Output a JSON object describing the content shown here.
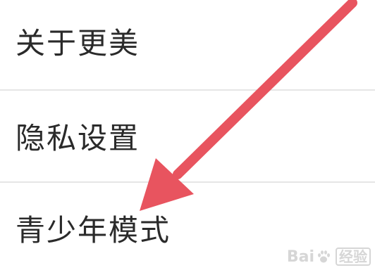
{
  "menu": {
    "items": [
      {
        "label": "关于更美"
      },
      {
        "label": "隐私设置"
      },
      {
        "label": "青少年模式"
      }
    ]
  },
  "annotation": {
    "arrow_color": "#e8545f",
    "arrow_icon": "pointing-arrow-icon"
  },
  "watermark": {
    "brand_left": "Bai",
    "brand_right": "经验",
    "color": "#c8c8c8"
  }
}
